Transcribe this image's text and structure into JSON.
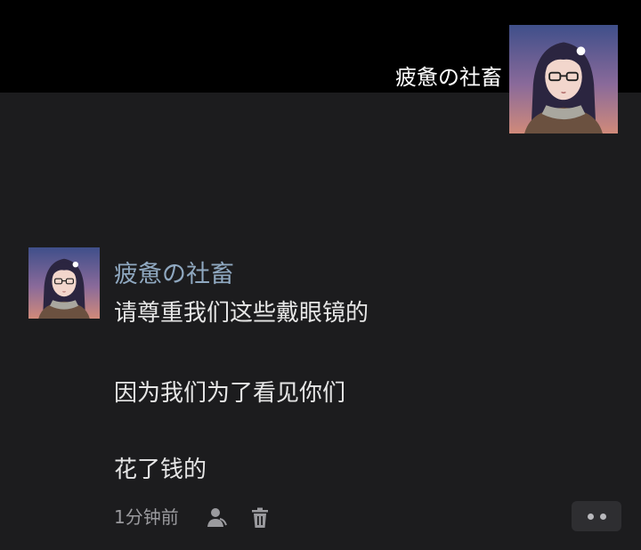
{
  "header": {
    "username": "疲惫の社畜",
    "avatar_icon": "anime-girl-glasses-avatar"
  },
  "comment": {
    "author": "疲惫の社畜",
    "avatar_icon": "anime-girl-glasses-avatar",
    "lines": [
      "请尊重我们这些戴眼镜的",
      "因为我们为了看见你们",
      "花了钱的"
    ],
    "time": "1分钟前",
    "actions": {
      "profile_icon": "person-icon",
      "delete_icon": "trash-icon",
      "more_icon": "more-dots-icon"
    }
  },
  "colors": {
    "background": "#1c1c1e",
    "top_bar": "#000000",
    "author_name": "#8fa8c0",
    "text": "#e6e6e6",
    "meta": "#9a9a9e"
  }
}
